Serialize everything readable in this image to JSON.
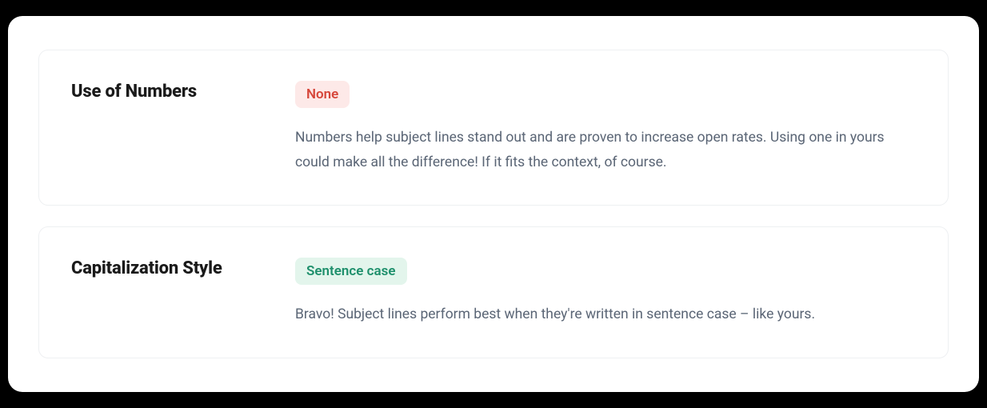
{
  "sections": [
    {
      "title": "Use of Numbers",
      "badge": {
        "label": "None",
        "variant": "red"
      },
      "description": "Numbers help subject lines stand out and are proven to increase open rates. Using one in yours could make all the difference! If it fits the context, of course."
    },
    {
      "title": "Capitalization Style",
      "badge": {
        "label": "Sentence case",
        "variant": "green"
      },
      "description": "Bravo! Subject lines perform best when they're written in sentence case – like yours."
    }
  ]
}
